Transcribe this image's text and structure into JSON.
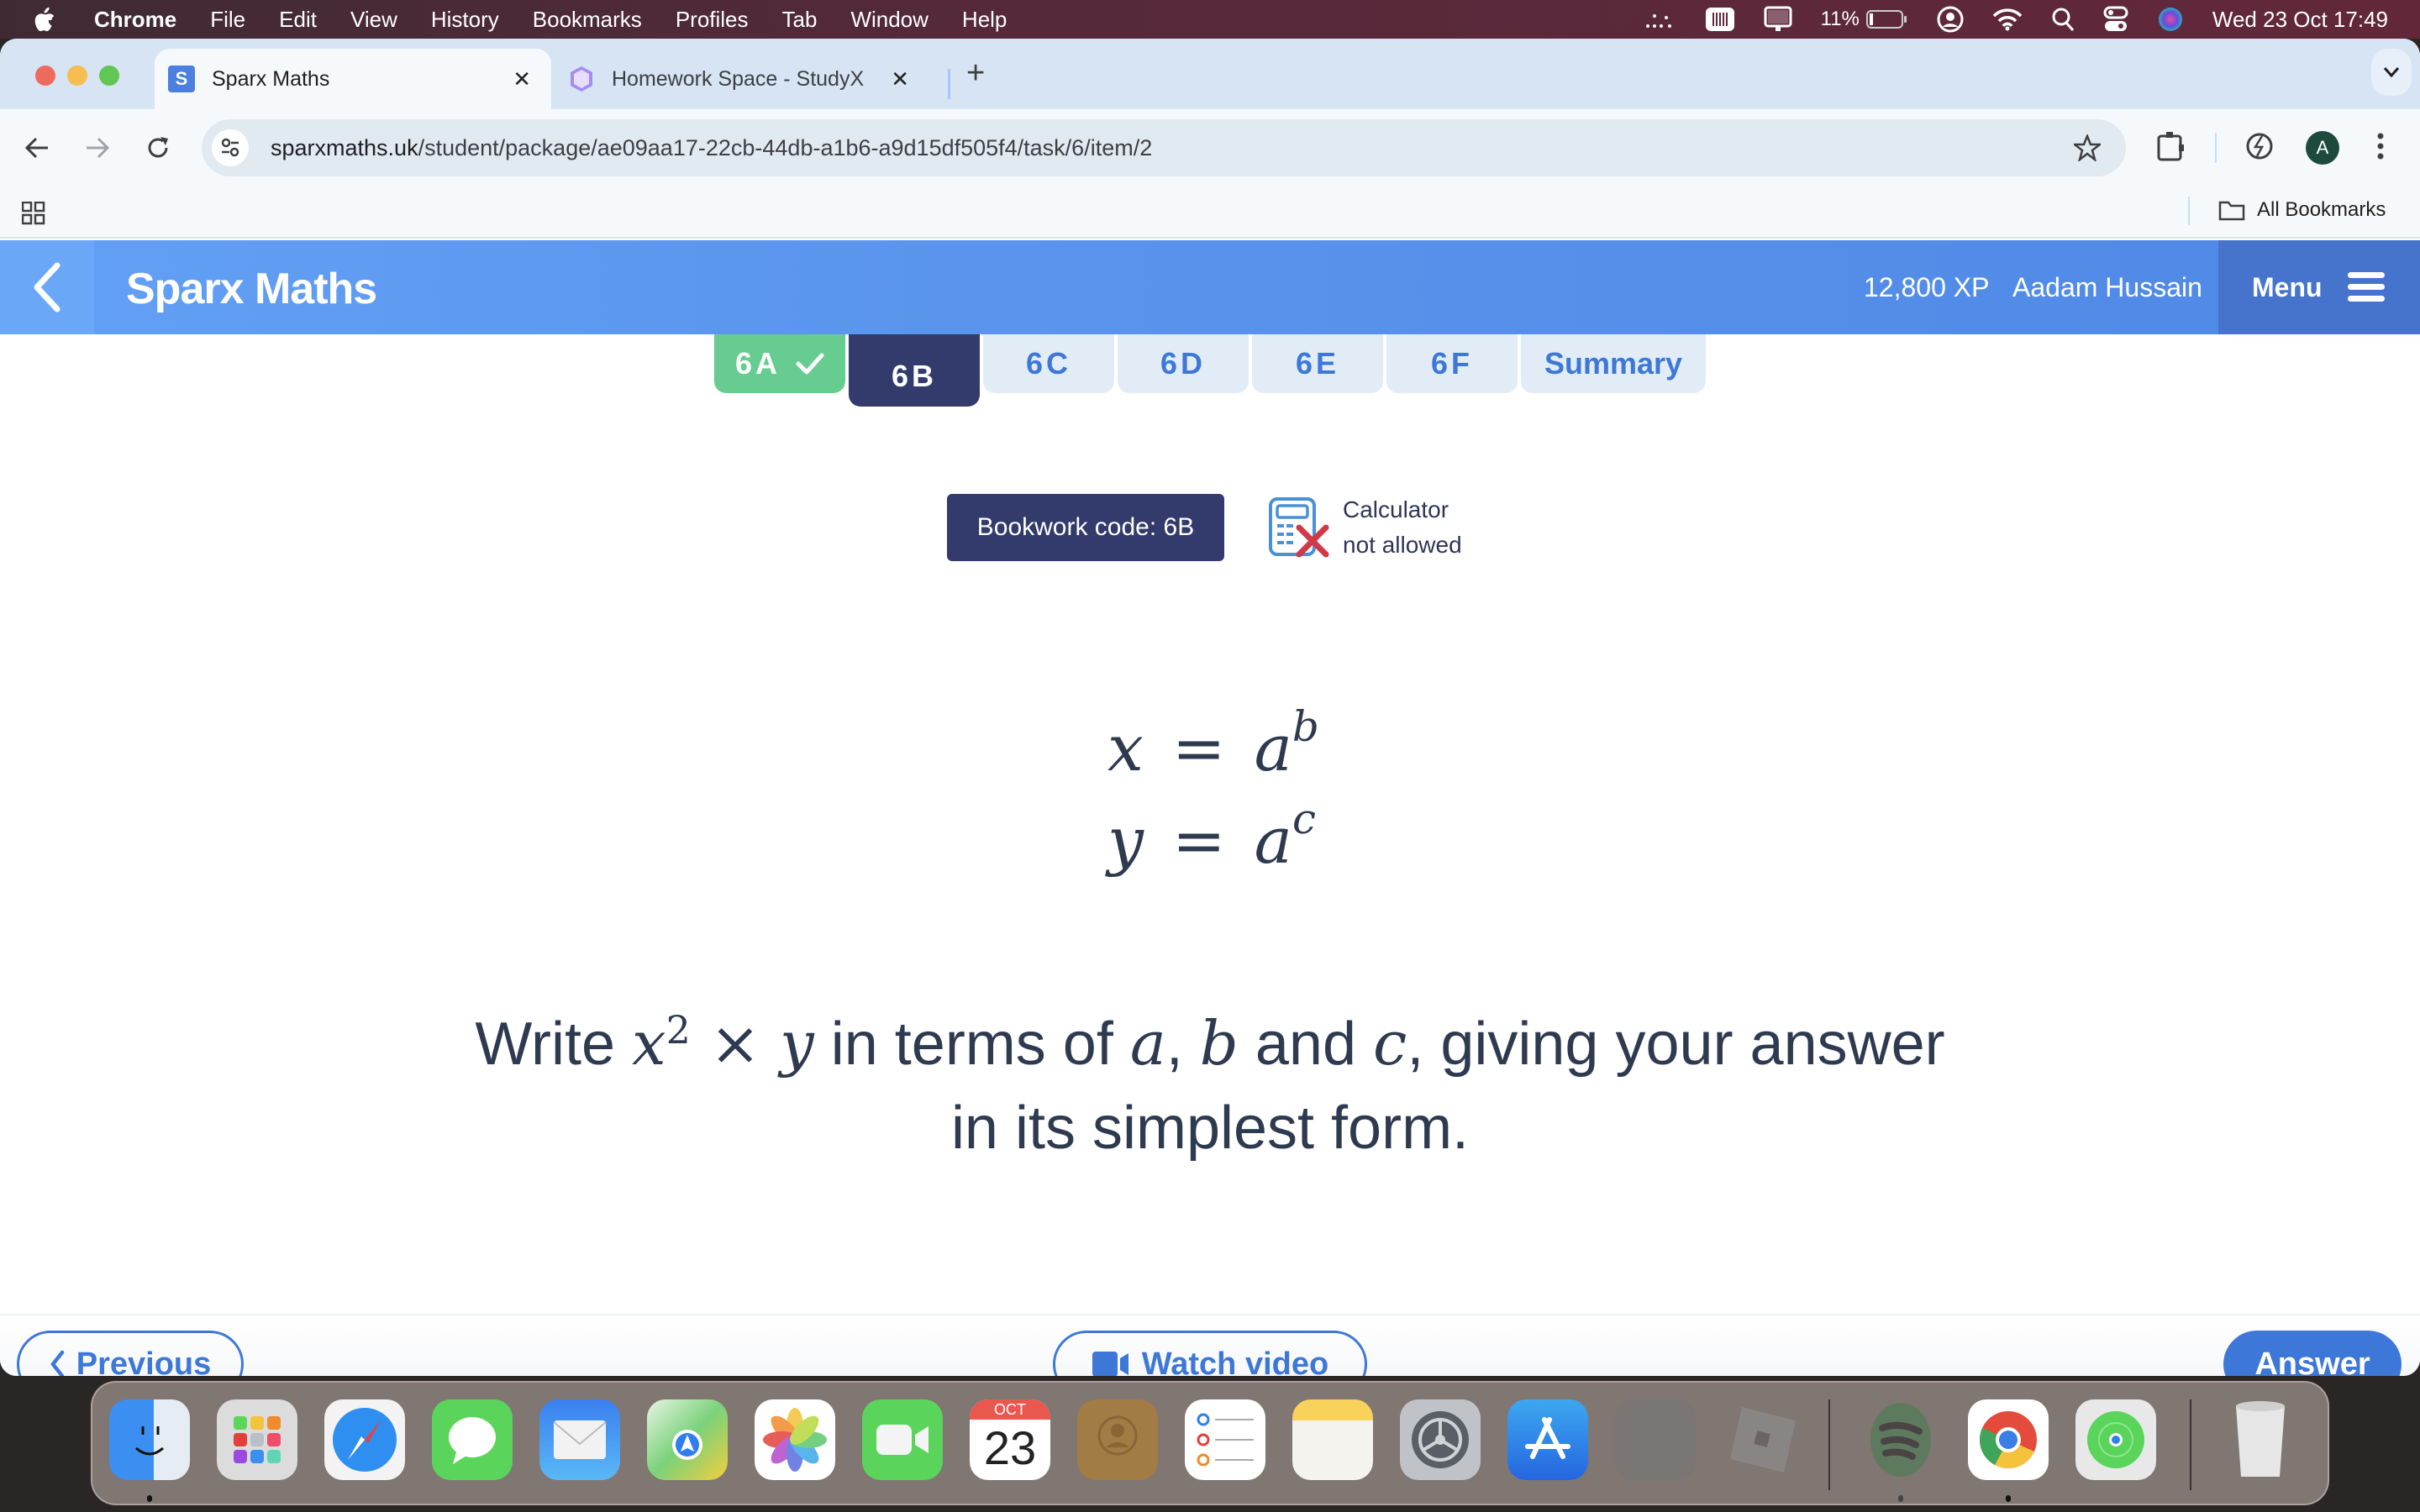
{
  "menubar": {
    "app_name": "Chrome",
    "items": [
      "File",
      "Edit",
      "View",
      "History",
      "Bookmarks",
      "Profiles",
      "Tab",
      "Window",
      "Help"
    ],
    "battery_percent": "11%",
    "datetime": "Wed 23 Oct  17:49"
  },
  "browser": {
    "tabs": [
      {
        "title": "Sparx Maths",
        "favicon": "S",
        "active": true
      },
      {
        "title": "Homework Space - StudyX",
        "active": false
      }
    ],
    "url_host": "sparxmaths.uk",
    "url_path": "/student/package/ae09aa17-22cb-44db-a1b6-a9d15df505f4/task/6/item/2",
    "profile_initial": "A",
    "all_bookmarks_label": "All Bookmarks"
  },
  "header": {
    "brand": "Sparx Maths",
    "xp": "12,800 XP",
    "user_name": "Aadam Hussain",
    "menu_label": "Menu"
  },
  "task_tabs": [
    {
      "label": "6A",
      "state": "done"
    },
    {
      "label": "6B",
      "state": "current"
    },
    {
      "label": "6C",
      "state": "todo"
    },
    {
      "label": "6D",
      "state": "todo"
    },
    {
      "label": "6E",
      "state": "todo"
    },
    {
      "label": "6F",
      "state": "todo"
    },
    {
      "label": "Summary",
      "state": "todo"
    }
  ],
  "bookwork_code": "Bookwork code: 6B",
  "calculator": {
    "line1": "Calculator",
    "line2": "not allowed"
  },
  "equations": [
    {
      "lhs": "x",
      "base": "a",
      "exp": "b"
    },
    {
      "lhs": "y",
      "base": "a",
      "exp": "c"
    }
  ],
  "question": {
    "w1": "Write ",
    "var_x": "x",
    "pow": "2",
    "times": " × ",
    "var_y": "y",
    "w2": " in terms of ",
    "var_a": "a",
    "comma1": ", ",
    "var_b": "b",
    "w3": " and ",
    "var_c": "c",
    "w4": ", giving your answer",
    "line2": "in its simplest form."
  },
  "footer": {
    "previous_label": "Previous",
    "video_label": "Watch video",
    "answer_label": "Answer"
  },
  "dock": {
    "calendar_month": "OCT",
    "calendar_day": "23",
    "apps": [
      "Finder",
      "Launchpad",
      "Safari",
      "Messages",
      "Mail",
      "Maps",
      "Photos",
      "FaceTime",
      "Calendar",
      "Contacts",
      "Reminders",
      "Notes",
      "System Settings",
      "App Store",
      "Preview",
      "Roblox",
      "Spotify",
      "Google Chrome",
      "Find My",
      "Trash"
    ]
  }
}
